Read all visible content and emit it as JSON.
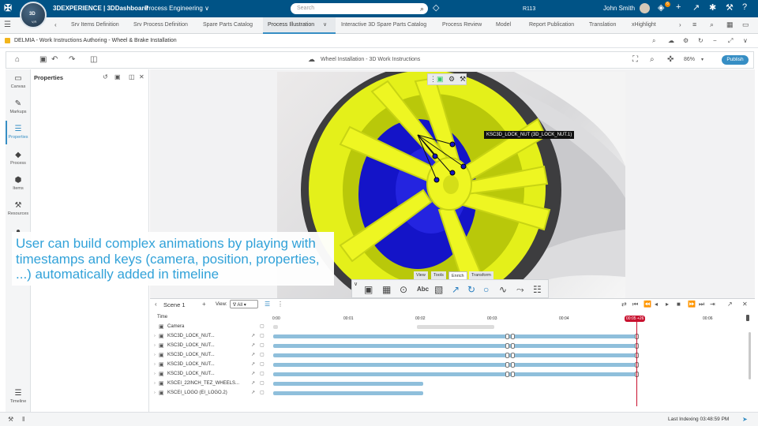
{
  "topbar": {
    "brand": "3DEXPERIENCE | 3DDashboard",
    "app": "Process Engineering",
    "search_placeholder": "Search",
    "release": "R113",
    "user": "John Smith",
    "notif_count": "6",
    "compass_label": "3D",
    "compass_sub": "V,R"
  },
  "tabs": [
    "Srv Items Definition",
    "Srv Process Definition",
    "Spare Parts Catalog",
    "Process Illustration",
    "Interactive 3D Spare Parts Catalog",
    "Process Review",
    "Model",
    "Report Publication",
    "Translation",
    "xHighlight"
  ],
  "app_header": {
    "title": "DELMIA - Work Instructions Authoring - Wheel & Brake Installation"
  },
  "toolbar": {
    "doc_title": "Wheel Installation - 3D Work Instructions",
    "zoom": "86%",
    "publish_label": "Publish"
  },
  "rail": [
    {
      "label": "Canvas",
      "icon": "canvas-icon"
    },
    {
      "label": "Markups",
      "icon": "markups-icon"
    },
    {
      "label": "Properties",
      "icon": "properties-icon"
    },
    {
      "label": "Process",
      "icon": "process-icon"
    },
    {
      "label": "Items",
      "icon": "items-icon"
    },
    {
      "label": "Resources",
      "icon": "resources-icon"
    },
    {
      "label": "Timeline",
      "icon": "timeline-icon"
    }
  ],
  "properties_panel": {
    "title": "Properties"
  },
  "viewport": {
    "callout": "KSC3D_LOCK_NUT (3D_LOCK_NUT.1)"
  },
  "caption": {
    "text": "User can build complex animations by playing with timestamps and keys (camera, position, properties, ...) automatically added in timeline"
  },
  "context_tabs": [
    "View",
    "Tools",
    "Enrich",
    "Transform"
  ],
  "timeline": {
    "scene": "Scene 1",
    "view_label": "View:",
    "filter_value": "All",
    "time_label": "Time",
    "ticks": [
      "0:00",
      "00:01",
      "00:02",
      "00:03",
      "00:04",
      "00:05",
      "00:06"
    ],
    "playhead": "00:05 +26",
    "rows": [
      {
        "name": "Camera"
      },
      {
        "name": "KSC3D_LOCK_NUT..."
      },
      {
        "name": "KSC3D_LOCK_NUT..."
      },
      {
        "name": "KSC3D_LOCK_NUT..."
      },
      {
        "name": "KSC3D_LOCK_NUT..."
      },
      {
        "name": "KSC3D_LOCK_NUT..."
      },
      {
        "name": "KSCEI_22INCH_TEZ_WHEELS..."
      },
      {
        "name": "KSCEI_LOGO (EI_LOGO.2)"
      }
    ]
  },
  "status": {
    "text": "Last Indexing 03:48:59 PM"
  }
}
